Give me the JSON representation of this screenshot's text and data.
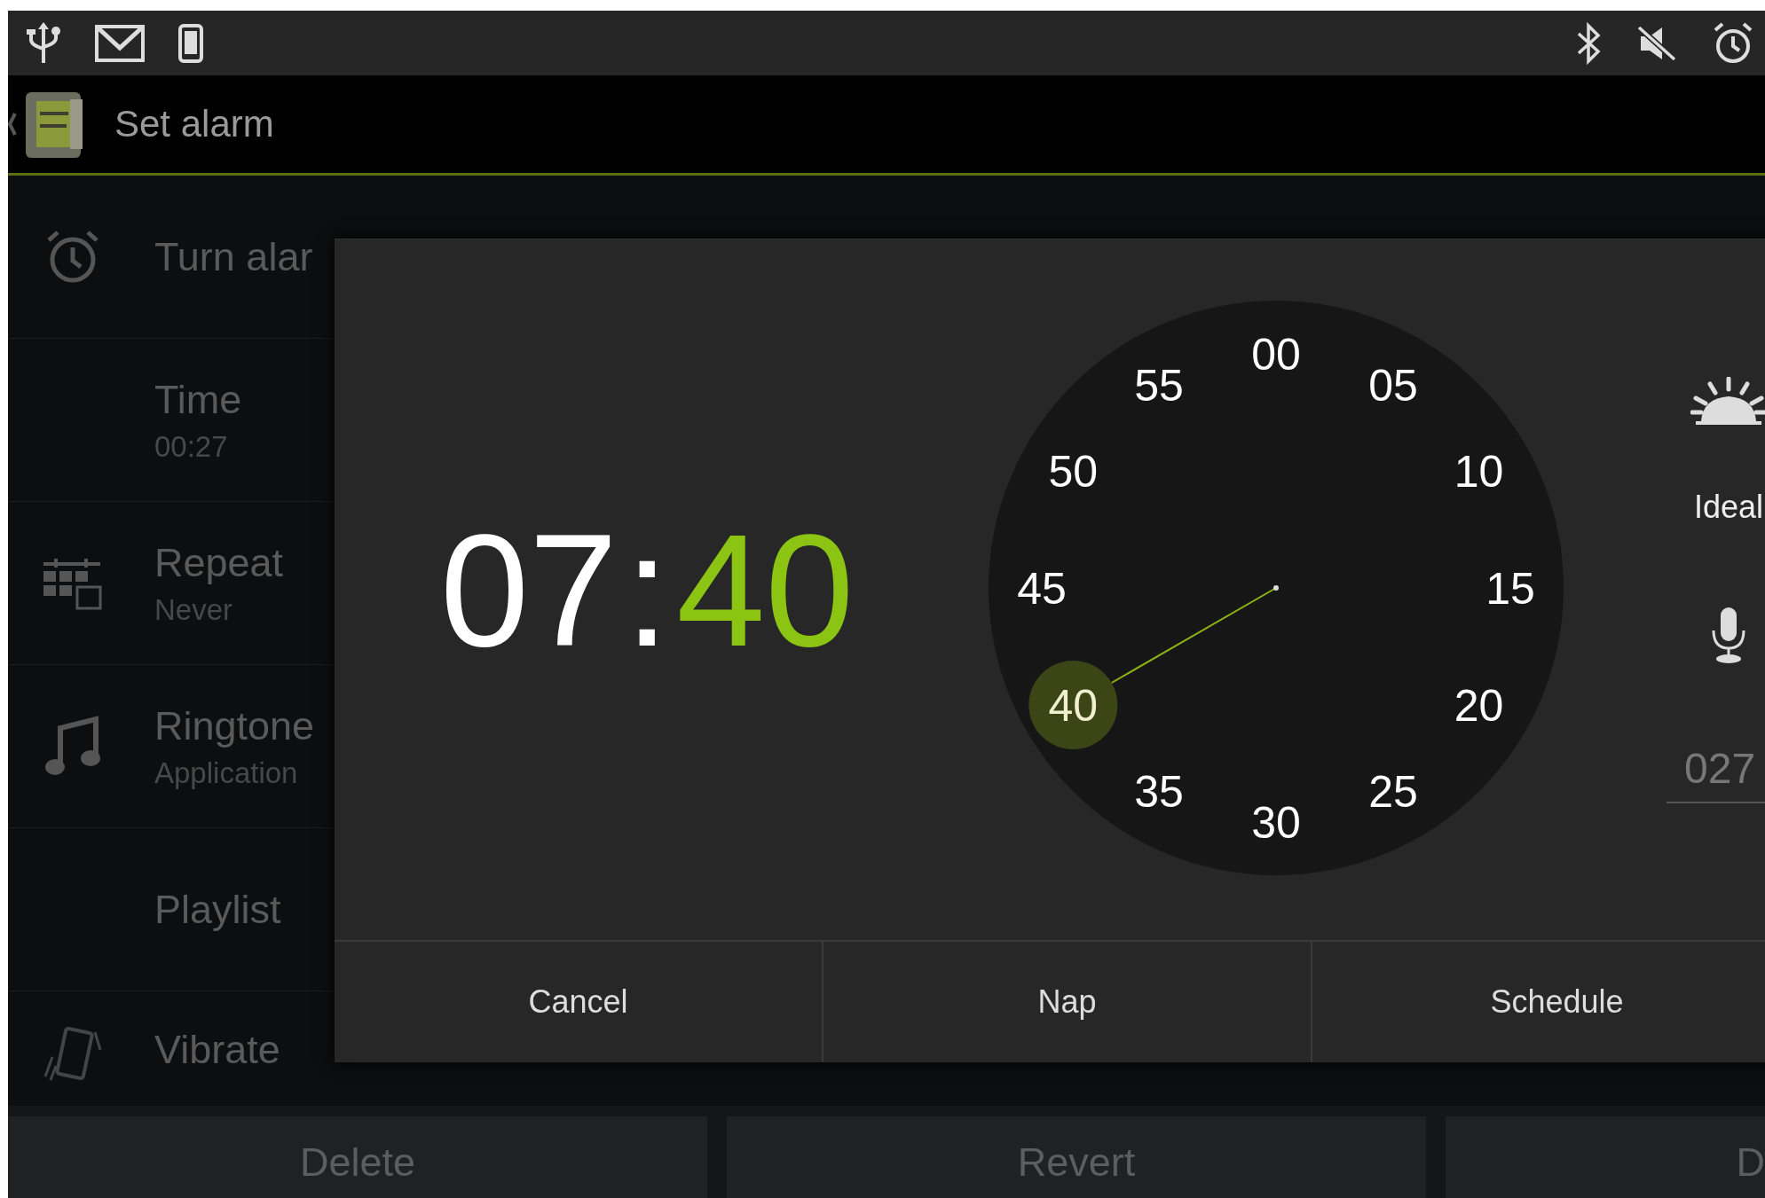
{
  "action_bar": {
    "title": "Set alarm"
  },
  "settings": [
    {
      "title": "Turn alar"
    },
    {
      "title": "Time",
      "summary": "00:27"
    },
    {
      "title": "Repeat",
      "summary": "Never"
    },
    {
      "title": "Ringtone",
      "summary": "Application"
    },
    {
      "title": "Playlist"
    },
    {
      "title": "Vibrate"
    }
  ],
  "dialog": {
    "hours": "07",
    "separator": ":",
    "minutes": "40",
    "dial": [
      {
        "label": "00",
        "selected": false
      },
      {
        "label": "05",
        "selected": false
      },
      {
        "label": "10",
        "selected": false
      },
      {
        "label": "15",
        "selected": false
      },
      {
        "label": "20",
        "selected": false
      },
      {
        "label": "25",
        "selected": false
      },
      {
        "label": "30",
        "selected": false
      },
      {
        "label": "35",
        "selected": false
      },
      {
        "label": "40",
        "selected": true
      },
      {
        "label": "45",
        "selected": false
      },
      {
        "label": "50",
        "selected": false
      },
      {
        "label": "55",
        "selected": false
      }
    ],
    "side_label": "Ideal",
    "field_value": "027",
    "buttons": [
      "Cancel",
      "Nap",
      "Schedule"
    ]
  },
  "bottom_buttons": [
    "Delete",
    "Revert",
    "D"
  ]
}
